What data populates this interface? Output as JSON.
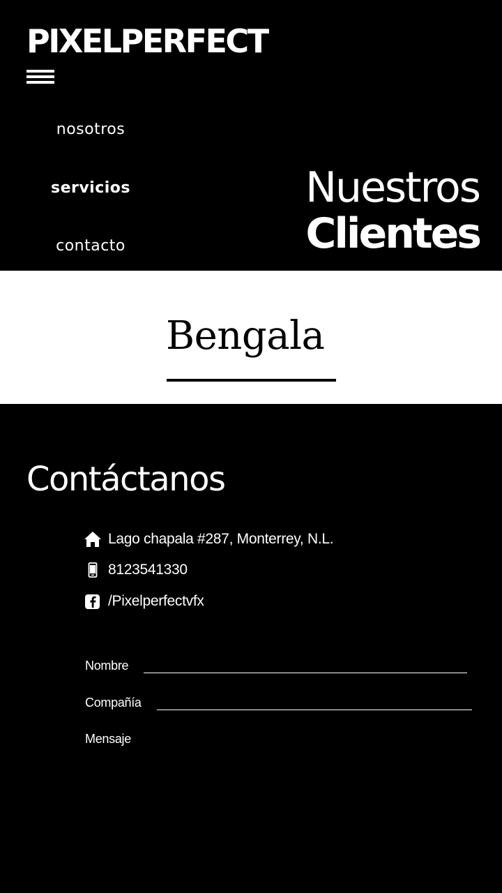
{
  "header": {
    "brand": "PIXELPERFECT"
  },
  "nav": {
    "items": [
      {
        "label": "nosotros",
        "active": false
      },
      {
        "label": "servicios",
        "active": true
      },
      {
        "label": "contacto",
        "active": false
      }
    ]
  },
  "clients": {
    "heading_light": "Nuestros",
    "heading_bold": "Clientes",
    "logo_name": "Bengala"
  },
  "contact": {
    "title": "Contáctanos",
    "address": "Lago chapala #287, Monterrey, N.L.",
    "phone": "8123541330",
    "facebook": "/Pixelperfectvfx",
    "icons": {
      "address": "home-icon",
      "phone": "phone-icon",
      "facebook": "facebook-icon"
    }
  },
  "form": {
    "name_label": "Nombre",
    "company_label": "Compañía",
    "message_label": "Mensaje"
  }
}
